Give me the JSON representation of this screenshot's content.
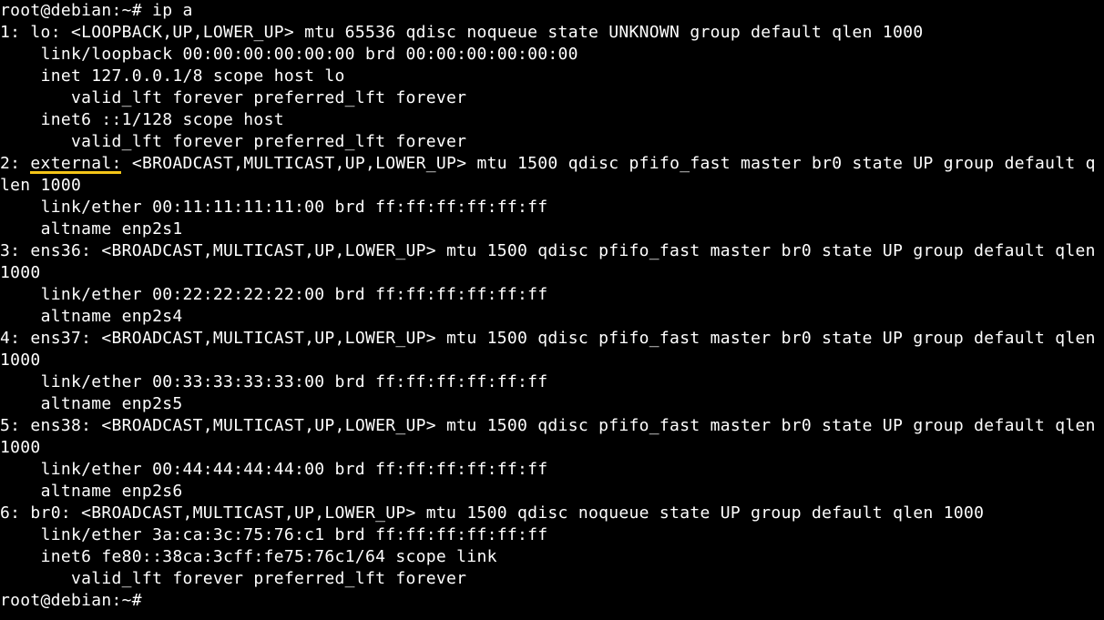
{
  "prompt1": {
    "prompt": "root@debian:~#",
    "command": " ip a"
  },
  "ifaces": [
    {
      "idx": "1",
      "name": "lo",
      "sep": ": ",
      "tail": "<LOOPBACK,UP,LOWER_UP> mtu 65536 qdisc noqueue state UNKNOWN group default qlen 1000",
      "lines": [
        "    link/loopback 00:00:00:00:00:00 brd 00:00:00:00:00:00",
        "    inet 127.0.0.1/8 scope host lo",
        "       valid_lft forever preferred_lft forever",
        "    inet6 ::1/128 scope host",
        "       valid_lft forever preferred_lft forever"
      ],
      "underline": false
    },
    {
      "idx": "2",
      "name": "external",
      "sep": ": ",
      "tail": "<BROADCAST,MULTICAST,UP,LOWER_UP> mtu 1500 qdisc pfifo_fast master br0 state UP group default qlen 1000",
      "lines": [
        "    link/ether 00:11:11:11:11:00 brd ff:ff:ff:ff:ff:ff",
        "    altname enp2s1"
      ],
      "underline": true
    },
    {
      "idx": "3",
      "name": "ens36",
      "sep": ": ",
      "tail": "<BROADCAST,MULTICAST,UP,LOWER_UP> mtu 1500 qdisc pfifo_fast master br0 state UP group default qlen 1000",
      "lines": [
        "    link/ether 00:22:22:22:22:00 brd ff:ff:ff:ff:ff:ff",
        "    altname enp2s4"
      ],
      "underline": false
    },
    {
      "idx": "4",
      "name": "ens37",
      "sep": ": ",
      "tail": "<BROADCAST,MULTICAST,UP,LOWER_UP> mtu 1500 qdisc pfifo_fast master br0 state UP group default qlen 1000",
      "lines": [
        "    link/ether 00:33:33:33:33:00 brd ff:ff:ff:ff:ff:ff",
        "    altname enp2s5"
      ],
      "underline": false
    },
    {
      "idx": "5",
      "name": "ens38",
      "sep": ": ",
      "tail": "<BROADCAST,MULTICAST,UP,LOWER_UP> mtu 1500 qdisc pfifo_fast master br0 state UP group default qlen 1000",
      "lines": [
        "    link/ether 00:44:44:44:44:00 brd ff:ff:ff:ff:ff:ff",
        "    altname enp2s6"
      ],
      "underline": false
    },
    {
      "idx": "6",
      "name": "br0",
      "sep": ": ",
      "tail": "<BROADCAST,MULTICAST,UP,LOWER_UP> mtu 1500 qdisc noqueue state UP group default qlen 1000",
      "lines": [
        "    link/ether 3a:ca:3c:75:76:c1 brd ff:ff:ff:ff:ff:ff",
        "    inet6 fe80::38ca:3cff:fe75:76c1/64 scope link",
        "       valid_lft forever preferred_lft forever"
      ],
      "underline": false
    }
  ],
  "prompt2": {
    "prompt": "root@debian:~#",
    "command": ""
  }
}
